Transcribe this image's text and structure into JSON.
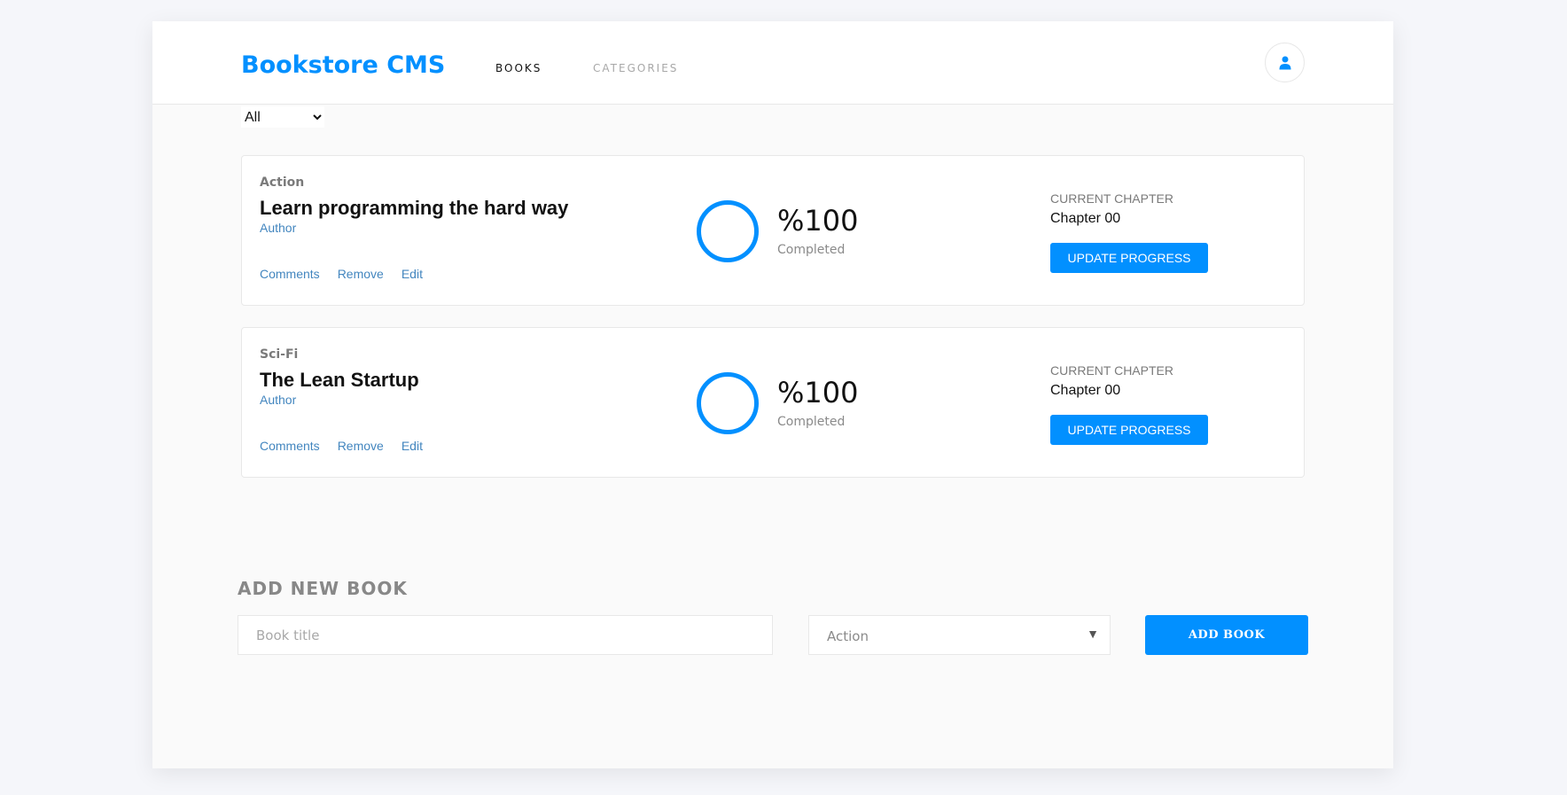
{
  "header": {
    "logo": "Bookstore CMS",
    "nav": {
      "books": "BOOKS",
      "categories": "CATEGORIES"
    },
    "user_icon": "user-icon"
  },
  "filter": {
    "value": "All"
  },
  "books": [
    {
      "genre": "Action",
      "title": "Learn programming the hard way",
      "author": "Author",
      "actions": {
        "comments": "Comments",
        "remove": "Remove",
        "edit": "Edit"
      },
      "progress": {
        "percent": "%100",
        "completed_label": "Completed"
      },
      "chapter": {
        "label": "CURRENT CHAPTER",
        "value": "Chapter 00",
        "button": "UPDATE PROGRESS"
      }
    },
    {
      "genre": "Sci-Fi",
      "title": "The Lean Startup",
      "author": "Author",
      "actions": {
        "comments": "Comments",
        "remove": "Remove",
        "edit": "Edit"
      },
      "progress": {
        "percent": "%100",
        "completed_label": "Completed"
      },
      "chapter": {
        "label": "CURRENT CHAPTER",
        "value": "Chapter 00",
        "button": "UPDATE PROGRESS"
      }
    }
  ],
  "add_book": {
    "heading": "ADD NEW BOOK",
    "title_placeholder": "Book title",
    "category_value": "Action",
    "button": "ADD BOOK"
  },
  "colors": {
    "accent": "#0290ff",
    "link": "#4386bf"
  }
}
